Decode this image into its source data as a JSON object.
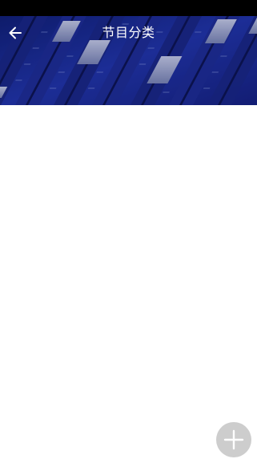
{
  "header": {
    "title": "节目分类",
    "back_icon": "arrow-left-icon",
    "background": "mixing-console-banner"
  },
  "fab": {
    "icon": "plus-icon"
  },
  "colors": {
    "status_bar": "#000000",
    "header_tint": "#1b2a86",
    "fab_background": "#cdcdcd",
    "fab_icon": "#ffffff",
    "title_text": "#ffffff"
  }
}
